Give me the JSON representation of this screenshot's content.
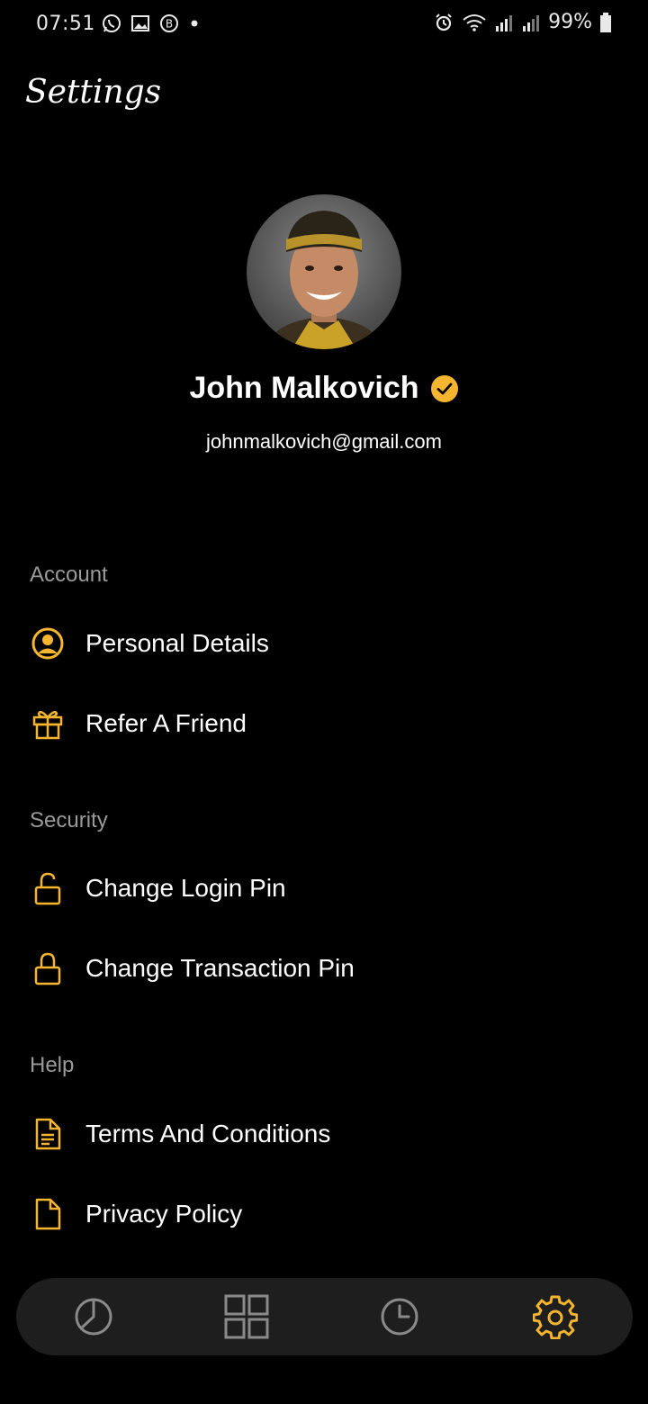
{
  "status_bar": {
    "time": "07:51",
    "battery": "99%",
    "left_icons": [
      "whatsapp-icon",
      "gallery-icon",
      "b-badge-icon",
      "dot-icon"
    ],
    "right_icons": [
      "alarm-icon",
      "wifi-icon",
      "signal-icon",
      "signal-icon",
      "battery-icon"
    ]
  },
  "page": {
    "title": "Settings"
  },
  "profile": {
    "name": "John Malkovich",
    "email": "johnmalkovich@gmail.com",
    "verified_icon": "verified-check-icon"
  },
  "sections": {
    "account": {
      "title": "Account",
      "items": [
        {
          "label": "Personal Details",
          "icon": "user-circle-icon"
        },
        {
          "label": "Refer A Friend",
          "icon": "gift-icon"
        }
      ]
    },
    "security": {
      "title": "Security",
      "items": [
        {
          "label": "Change Login Pin",
          "icon": "unlock-icon"
        },
        {
          "label": "Change Transaction Pin",
          "icon": "lock-icon"
        }
      ]
    },
    "help": {
      "title": "Help",
      "items": [
        {
          "label": "Terms And Conditions",
          "icon": "document-icon"
        },
        {
          "label": "Privacy Policy",
          "icon": "file-icon"
        }
      ]
    }
  },
  "bottom_nav": {
    "items": [
      {
        "icon": "pie-chart-icon",
        "active": false
      },
      {
        "icon": "grid-icon",
        "active": false
      },
      {
        "icon": "clock-icon",
        "active": false
      },
      {
        "icon": "gear-icon",
        "active": true
      }
    ]
  },
  "colors": {
    "accent": "#F5B52E",
    "background": "#000000",
    "nav_background": "#1E1E1E",
    "muted_text": "#9A9A9A",
    "inactive_icon": "#8A8A8A"
  }
}
